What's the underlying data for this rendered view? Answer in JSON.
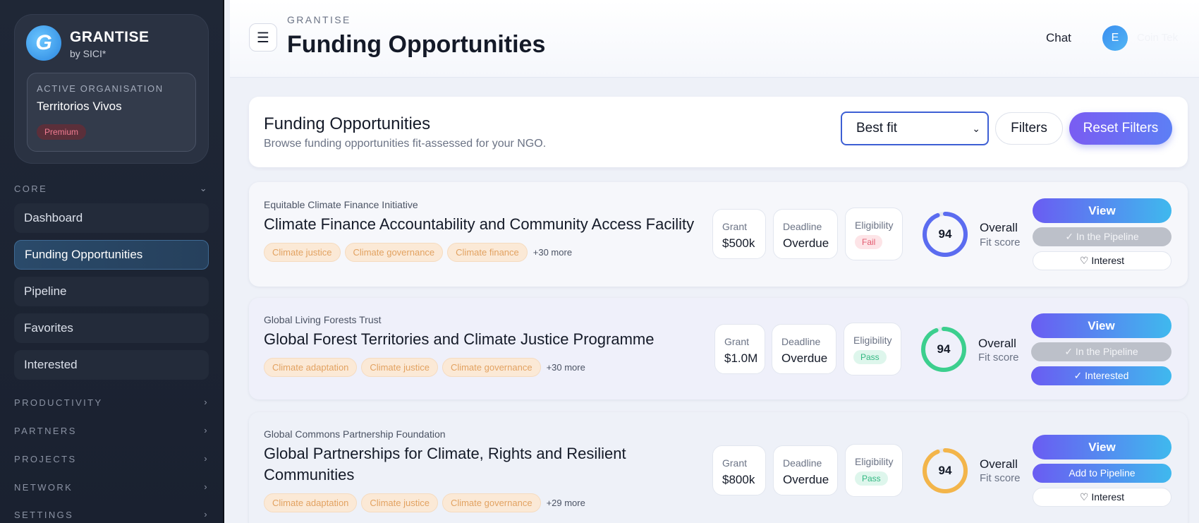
{
  "brand": {
    "logo_letter": "G",
    "name": "GRANTISE",
    "sub": "by SICI*"
  },
  "org": {
    "label": "ACTIVE ORGANISATION",
    "name": "Territorios Vivos",
    "plan": "Premium"
  },
  "nav": {
    "core_label": "CORE",
    "items": [
      "Dashboard",
      "Funding Opportunities",
      "Pipeline",
      "Favorites",
      "Interested"
    ],
    "sections": [
      "PRODUCTIVITY",
      "PARTNERS",
      "PROJECTS",
      "NETWORK",
      "SETTINGS"
    ]
  },
  "header": {
    "crumb": "GRANTISE",
    "title": "Funding Opportunities",
    "chat": "Chat",
    "avatar": "E",
    "user": "Coin Tek"
  },
  "intro": {
    "title": "Funding Opportunities",
    "subtitle": "Browse funding opportunities fit-assessed for your NGO.",
    "sort_value": "Best fit",
    "filters": "Filters",
    "reset": "Reset Filters"
  },
  "labels": {
    "grant": "Grant",
    "deadline": "Deadline",
    "eligibility": "Eligibility",
    "overall": "Overall",
    "fit": "Fit score",
    "view": "View"
  },
  "colors": {
    "ring_blue": "#5b6cf0",
    "ring_green": "#3ccf8e",
    "ring_orange": "#f3b54a",
    "accent": "#6a5cf2"
  },
  "cards": [
    {
      "funder": "Equitable Climate Finance Initiative",
      "title": "Climate Finance Accountability and Community Access Facility",
      "tags": [
        "Climate justice",
        "Climate governance",
        "Climate finance"
      ],
      "more": "+30 more",
      "grant": "$500k",
      "deadline": "Overdue",
      "eligibility": "Fail",
      "score": "94",
      "btn2": "✓ In the Pipeline",
      "btn3": "♡ Interest"
    },
    {
      "funder": "Global Living Forests Trust",
      "title": "Global Forest Territories and Climate Justice Programme",
      "tags": [
        "Climate adaptation",
        "Climate justice",
        "Climate governance"
      ],
      "more": "+30 more",
      "grant": "$1.0M",
      "deadline": "Overdue",
      "eligibility": "Pass",
      "score": "94",
      "btn2": "✓ In the Pipeline",
      "btn3": "✓ Interested"
    },
    {
      "funder": "Global Commons Partnership Foundation",
      "title_line1": "Global Partnerships for Climate, Rights and Resilient",
      "title_line2": "Communities",
      "tags": [
        "Climate adaptation",
        "Climate justice",
        "Climate governance"
      ],
      "more": "+29 more",
      "grant": "$800k",
      "deadline": "Overdue",
      "eligibility": "Pass",
      "score": "94",
      "btn2": "Add to Pipeline",
      "btn3": "♡ Interest"
    }
  ]
}
